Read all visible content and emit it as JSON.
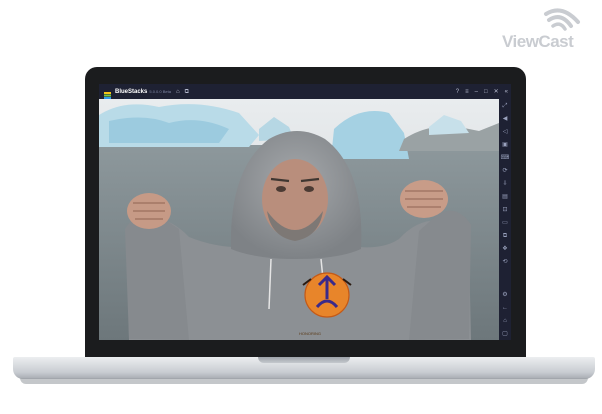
{
  "watermark": {
    "text": "ViewCast"
  },
  "window": {
    "app_name": "BlueStacks",
    "version": "5.0.0.0 Beta",
    "titlebar_left_icons": [
      "home-icon",
      "multi-instance-icon"
    ],
    "titlebar_right_icons": [
      "help-icon",
      "menu-icon",
      "minimize-icon",
      "maximize-icon",
      "close-icon",
      "collapse-sidebar-icon"
    ],
    "titlebar_right_glyphs": [
      "?",
      "≡",
      "–",
      "□",
      "✕",
      "«"
    ]
  },
  "sidebar": {
    "top_icons": [
      "fullscreen-icon",
      "volume-up-icon",
      "volume-down-icon",
      "screen-record-icon",
      "keyboard-controls-icon",
      "macro-icon",
      "install-apk-icon",
      "multi-instance-sidebar-icon",
      "screenshot-icon",
      "folder-icon",
      "copy-icon",
      "eco-mode-icon",
      "sync-icon"
    ],
    "top_glyphs": [
      "⤢",
      "◀",
      "◁",
      "▣",
      "⌨",
      "⟳",
      "⇩",
      "▤",
      "⊡",
      "▭",
      "⧉",
      "❖",
      "⟲"
    ],
    "bottom_icons": [
      "settings-icon",
      "back-icon",
      "home-nav-icon",
      "recent-apps-icon"
    ],
    "bottom_glyphs": [
      "⚙",
      "←",
      "⌂",
      "▢"
    ]
  },
  "content": {
    "shirt_logo_text": "HONORING"
  },
  "colors": {
    "titlebar": "#1e2133",
    "sky": "#dfe3e6",
    "ice": "#a9d4e6",
    "water": "#7f8c91",
    "hoodie": "#8c8f93",
    "logo_orange": "#e8852a"
  }
}
